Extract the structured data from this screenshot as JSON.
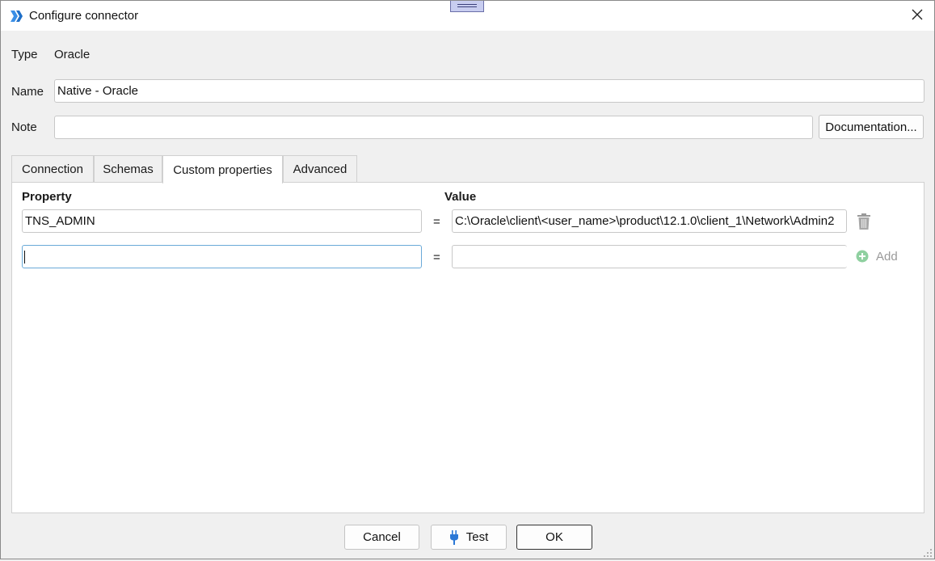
{
  "window": {
    "title": "Configure connector"
  },
  "form": {
    "type_label": "Type",
    "type_value": "Oracle",
    "name_label": "Name",
    "name_value": "Native - Oracle",
    "note_label": "Note",
    "note_value": "",
    "documentation_label": "Documentation..."
  },
  "tabs": [
    {
      "label": "Connection",
      "active": false
    },
    {
      "label": "Schemas",
      "active": false
    },
    {
      "label": "Custom properties",
      "active": true
    },
    {
      "label": "Advanced",
      "active": false
    }
  ],
  "custom_properties": {
    "property_header": "Property",
    "value_header": "Value",
    "equals": "=",
    "rows": [
      {
        "property": "TNS_ADMIN",
        "value": "C:\\Oracle\\client\\<user_name>\\product\\12.1.0\\client_1\\Network\\Admin2"
      }
    ],
    "new_row": {
      "property": "",
      "value": ""
    },
    "add_label": "Add"
  },
  "footer": {
    "cancel_label": "Cancel",
    "test_label": "Test",
    "ok_label": "OK"
  },
  "colors": {
    "accent": "#3b8fe6",
    "add_icon": "#8fd0a0",
    "focus_border": "#6aaad8"
  },
  "icons": {
    "app": "connector-logo-icon",
    "close": "close-icon",
    "delete": "trash-icon",
    "add": "plus-circle-icon",
    "test": "plug-icon"
  }
}
